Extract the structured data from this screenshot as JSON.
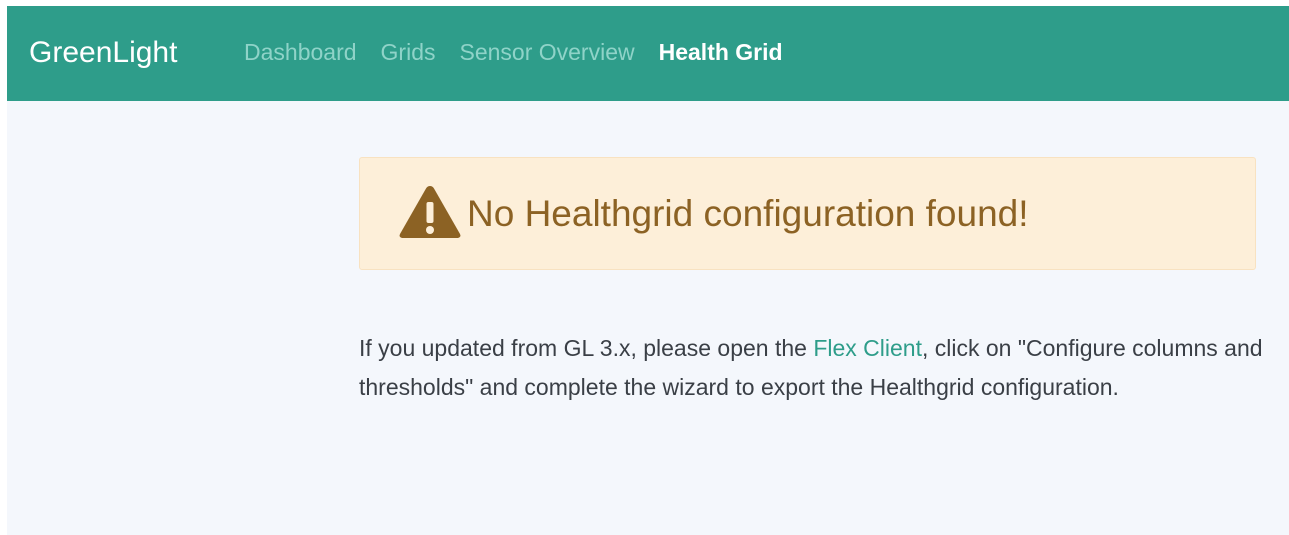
{
  "navbar": {
    "brand": "GreenLight",
    "links": [
      {
        "label": "Dashboard",
        "active": false
      },
      {
        "label": "Grids",
        "active": false
      },
      {
        "label": "Sensor Overview",
        "active": false
      },
      {
        "label": "Health Grid",
        "active": true
      }
    ]
  },
  "alert": {
    "icon": "warning-triangle-icon",
    "text": "No Healthgrid configuration found!"
  },
  "message": {
    "before_link": "If you updated from GL 3.x, please open the ",
    "link_text": "Flex Client",
    "after_link": ", click on \"Configure columns and thresholds\" and complete the wizard to export the Healthgrid configuration."
  },
  "colors": {
    "navbar": "#2e9d8a",
    "nav_link_inactive": "#8fd3c8",
    "nav_link_active": "#ffffff",
    "page_background": "#f4f7fc",
    "alert_background": "#fdefd9",
    "alert_text": "#8c6224",
    "link": "#2e9d8a"
  }
}
